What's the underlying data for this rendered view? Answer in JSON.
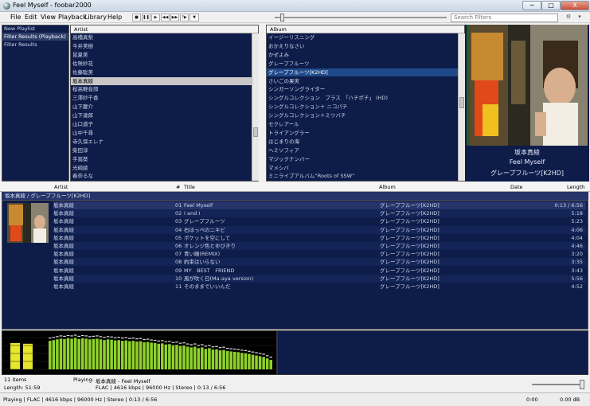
{
  "window": {
    "title": "Feel Myself - foobar2000",
    "minimize": "─",
    "maximize": "□",
    "close": "X"
  },
  "menu": [
    "File",
    "Edit",
    "View",
    "Playback",
    "Library",
    "Help"
  ],
  "toolbar": {
    "buttons": [
      "stop-icon",
      "pause-icon",
      "play-icon",
      "previous-icon",
      "next-icon",
      "random-icon",
      "playback-order-icon"
    ],
    "seek_fraction": 0.033
  },
  "search": {
    "placeholder": "Search Filters"
  },
  "left_panel": {
    "items": [
      "New Playlist",
      "Filter Results (Playback)",
      "Filter Results"
    ],
    "selected_index": 1
  },
  "artist_filter": {
    "header": "Artist",
    "rows": [
      "高橋真梨",
      "今井美樹",
      "昆夏美",
      "佐咲紗花",
      "佐藤聡美",
      "坂本真綾",
      "桜高軽音部",
      "三澤紗千香",
      "山下慶介",
      "山下達郎",
      "山口道子",
      "山中千尋",
      "寺久保エレナ",
      "柴田淳",
      "手嶌葵",
      "光崎綾",
      "春奈るな"
    ],
    "selected_index": 5
  },
  "album_filter": {
    "header": "Album",
    "rows": [
      "イージーリスニング",
      "おかえりなさい",
      "かぜよみ",
      "グレープフルーツ",
      "グレープフルーツ[K2HD]",
      "さいごの果実",
      "シンガーソングライター",
      "シングルコレクション　プラス　「ハチポチ」 (HD)",
      "シングルコレクション＋ ニコパチ",
      "シングルコレクション＋ミツバチ",
      "セクレアール",
      "トライアングラー",
      "はじまりの海",
      "ヘミソフィア",
      "マジックナンバー",
      "マメシバ",
      "ミニライブアルバム“Roots of SSW”"
    ],
    "selected_index": 4
  },
  "now_playing_panel": {
    "artist": "坂本真綾",
    "title": "Feel Myself",
    "album": "グレープフルーツ[K2HD]"
  },
  "playlist": {
    "columns": [
      "Artist",
      "#",
      "Title",
      "Album",
      "Date",
      "Length"
    ],
    "group_header": "坂本真綾 / グレープフルーツ[K2HD]",
    "rows": [
      {
        "artist": "坂本真綾",
        "num": "01",
        "title": "Feel Myself",
        "album": "グレープフルーツ[K2HD]",
        "length": "0:13 / 6:56",
        "playing": true
      },
      {
        "artist": "坂本真綾",
        "num": "02",
        "title": "I and I",
        "album": "グレープフルーツ[K2HD]",
        "length": "5:18"
      },
      {
        "artist": "坂本真綾",
        "num": "03",
        "title": "グレープフルーツ",
        "album": "グレープフルーツ[K2HD]",
        "length": "5:23"
      },
      {
        "artist": "坂本真綾",
        "num": "04",
        "title": "右ほっぺのニキビ",
        "album": "グレープフルーツ[K2HD]",
        "length": "4:06"
      },
      {
        "artist": "坂本真綾",
        "num": "05",
        "title": "ポケットを空にして",
        "album": "グレープフルーツ[K2HD]",
        "length": "4:04"
      },
      {
        "artist": "坂本真綾",
        "num": "06",
        "title": "オレンジ色とゆびきり",
        "album": "グレープフルーツ[K2HD]",
        "length": "4:46"
      },
      {
        "artist": "坂本真綾",
        "num": "07",
        "title": "青い瞳(REMIX)",
        "album": "グレープフルーツ[K2HD]",
        "length": "3:20"
      },
      {
        "artist": "坂本真綾",
        "num": "08",
        "title": "約束はいらない",
        "album": "グレープフルーツ[K2HD]",
        "length": "3:35"
      },
      {
        "artist": "坂本真綾",
        "num": "09",
        "title": "MY　BEST　FRIEND",
        "album": "グレープフルーツ[K2HD]",
        "length": "3:43"
      },
      {
        "artist": "坂本真綾",
        "num": "10",
        "title": "風が吹く日(Ma-aya version)",
        "album": "グレープフルーツ[K2HD]",
        "length": "5:56"
      },
      {
        "artist": "坂本真綾",
        "num": "11",
        "title": "そのままでいいんだ",
        "album": "グレープフルーツ[K2HD]",
        "length": "4:52"
      }
    ]
  },
  "visualizer": {
    "spectrum_levels": [
      0.78,
      0.8,
      0.82,
      0.84,
      0.83,
      0.85,
      0.84,
      0.86,
      0.83,
      0.85,
      0.84,
      0.82,
      0.83,
      0.84,
      0.82,
      0.8,
      0.82,
      0.81,
      0.79,
      0.8,
      0.78,
      0.79,
      0.77,
      0.78,
      0.76,
      0.77,
      0.74,
      0.75,
      0.73,
      0.72,
      0.7,
      0.71,
      0.68,
      0.69,
      0.66,
      0.67,
      0.64,
      0.65,
      0.62,
      0.6,
      0.62,
      0.58,
      0.6,
      0.56,
      0.58,
      0.54,
      0.55,
      0.52,
      0.53,
      0.5,
      0.49,
      0.48,
      0.47,
      0.45,
      0.44,
      0.42,
      0.4,
      0.38,
      0.36,
      0.34,
      0.3,
      0.26
    ],
    "vu_levels": [
      0.72,
      0.7
    ]
  },
  "bottom_info": {
    "items_label": "11 items",
    "length_label": "Length: 51:59",
    "playing_label": "Playing:",
    "playing_track": "坂本真綾 - Feel Myself",
    "format_line": "FLAC | 4616 kbps | 96000 Hz | Stereo | 0:13 / 6:56"
  },
  "status": {
    "left": "Playing | FLAC | 4616 kbps | 96000 Hz | Stereo | 0:13 / 6:56",
    "time": "0:00",
    "volume": "0.00 dB",
    "volume_fraction": 1.0
  },
  "colors": {
    "panel_bg": "#0e1c4a",
    "selection": "#1f4a8a",
    "spectrum_green": "#8fd22a",
    "spectrum_yellow": "#e6e62a"
  }
}
